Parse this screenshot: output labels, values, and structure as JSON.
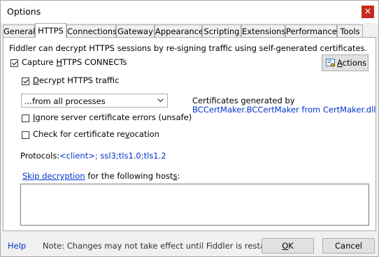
{
  "window": {
    "title": "Options",
    "close_glyph": "×"
  },
  "tabs": [
    {
      "label": "General"
    },
    {
      "label": "HTTPS"
    },
    {
      "label": "Connections"
    },
    {
      "label": "Gateway"
    },
    {
      "label": "Appearance"
    },
    {
      "label": "Scripting"
    },
    {
      "label": "Extensions"
    },
    {
      "label": "Performance"
    },
    {
      "label": "Tools"
    }
  ],
  "active_tab": "HTTPS",
  "https": {
    "intro": "Fiddler can decrypt HTTPS sessions by re-signing traffic using self-generated certificates.",
    "capture": {
      "before": "Capture ",
      "mnemonic": "H",
      "after": "TTPS CONNECTs",
      "checked": true
    },
    "decrypt": {
      "mnemonic": "D",
      "after": "ecrypt HTTPS traffic",
      "checked": true
    },
    "actions_button": {
      "mnemonic": "A",
      "after": "ctions",
      "icon": "certificate-icon"
    },
    "process_select": {
      "value": "...from all processes",
      "icon": "chevron-down-icon"
    },
    "ignore_errors": {
      "mnemonic": "I",
      "after": "gnore server certificate errors (unsafe)",
      "checked": false
    },
    "revocation": {
      "before": "Check for certificate re",
      "mnemonic": "v",
      "after": "ocation",
      "checked": false
    },
    "cert_generated_label": "Certificates generated by",
    "cert_maker_link": "BCCertMaker.BCCertMaker from CertMaker.dll",
    "protocols_label": "Protocols:",
    "protocols_link": "<client>; ssl3;tls1.0;tls1.2",
    "skip_link": "Skip decryption",
    "skip_before": " for the following host",
    "skip_mnemonic": "s",
    "skip_after": ":",
    "skip_hosts_value": ""
  },
  "footer": {
    "help": "Help",
    "note": "Note: Changes may not take effect until Fiddler is restarted.",
    "ok": {
      "mnemonic": "O",
      "after": "K"
    },
    "cancel": "Cancel"
  },
  "colors": {
    "link": "#0033cc",
    "close": "#c42b1c",
    "panel": "#ffffff",
    "chrome": "#f0f0f0"
  }
}
